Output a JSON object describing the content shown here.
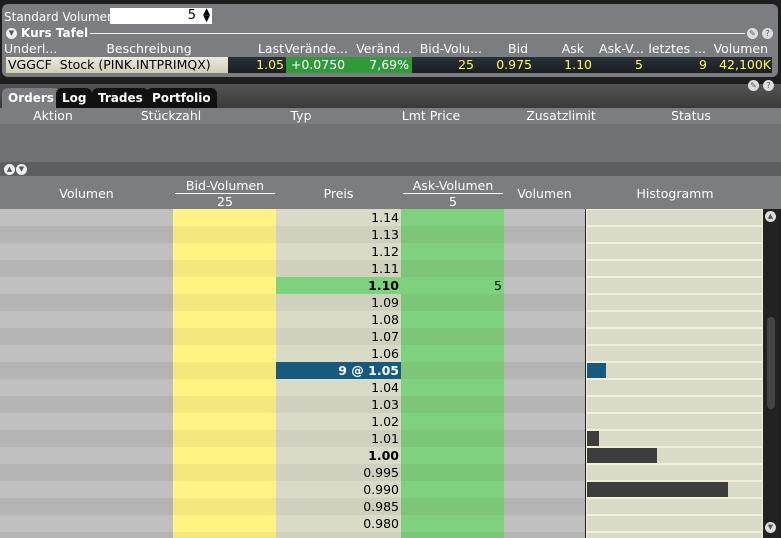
{
  "settings": {
    "std_volume_label": "Standard Volumen",
    "std_volume_value": "5"
  },
  "quote_board": {
    "title": "Kurs Tafel",
    "headers": [
      "Underl...",
      "Beschreibung",
      "Last",
      "Verände...",
      "Veränd...",
      "Bid-Volu...",
      "Bid",
      "Ask",
      "Ask-V...",
      "letztes ...",
      "Volumen"
    ],
    "row": {
      "symbol": "VGGCF",
      "description": "Stock (PINK.INTPRIMQX)",
      "last": "1.05",
      "change": "+0.0750",
      "change_pct": "7,69%",
      "bid_size": "25",
      "bid": "0.975",
      "ask": "1.10",
      "ask_size": "5",
      "last_size": "9",
      "volume": "42,100K"
    }
  },
  "tabs": [
    "Orders",
    "Log",
    "Trades",
    "Portfolio"
  ],
  "orders": {
    "headers": [
      "Aktion",
      "Stückzahl",
      "Typ",
      "Lmt Price",
      "Zusatzlimit",
      "Status"
    ]
  },
  "depth": {
    "headers": {
      "volume_left": "Volumen",
      "bid_volume": "Bid-Volumen",
      "bid_volume_total": "25",
      "price": "Preis",
      "ask_volume": "Ask-Volumen",
      "ask_volume_total": "5",
      "volume_right": "Volumen",
      "histogram": "Histogramm"
    },
    "rows": [
      {
        "price": "1.14"
      },
      {
        "price": "1.13"
      },
      {
        "price": "1.12"
      },
      {
        "price": "1.11"
      },
      {
        "price": "1.10",
        "ask_size": "5",
        "best_ask": true
      },
      {
        "price": "1.09"
      },
      {
        "price": "1.08"
      },
      {
        "price": "1.07"
      },
      {
        "price": "1.06"
      },
      {
        "price": "9 @ 1.05",
        "last": true,
        "hist": 0.11
      },
      {
        "price": "1.04"
      },
      {
        "price": "1.03"
      },
      {
        "price": "1.02"
      },
      {
        "price": "1.01",
        "hist": 0.07
      },
      {
        "price": "1.00",
        "bold": true,
        "hist": 0.4
      },
      {
        "price": "0.995"
      },
      {
        "price": "0.990",
        "hist": 0.8
      },
      {
        "price": "0.985"
      },
      {
        "price": "0.980"
      }
    ]
  },
  "colors": {
    "bid": "#fff383",
    "ask": "#7fd27d",
    "last_highlight": "#175a80",
    "hist_bar": "#3d3d3d",
    "quote_yellow": "#ffff40",
    "change_green": "#2e9a3a"
  }
}
